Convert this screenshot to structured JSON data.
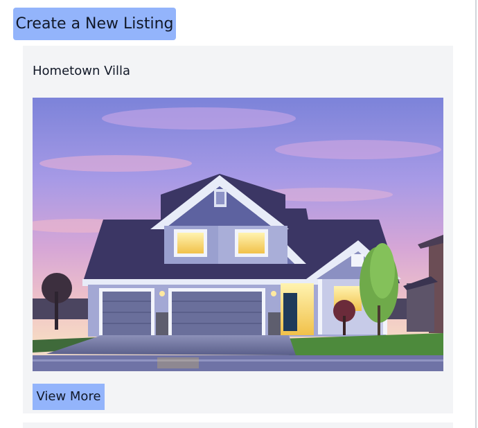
{
  "header": {
    "create_label": "Create a New Listing"
  },
  "listings": [
    {
      "title": "Hometown Villa",
      "view_label": "View More",
      "photo_alt": "Hometown Villa"
    }
  ],
  "colors": {
    "button": "#93b4fb",
    "card": "#f3f4f6",
    "text": "#111827"
  }
}
